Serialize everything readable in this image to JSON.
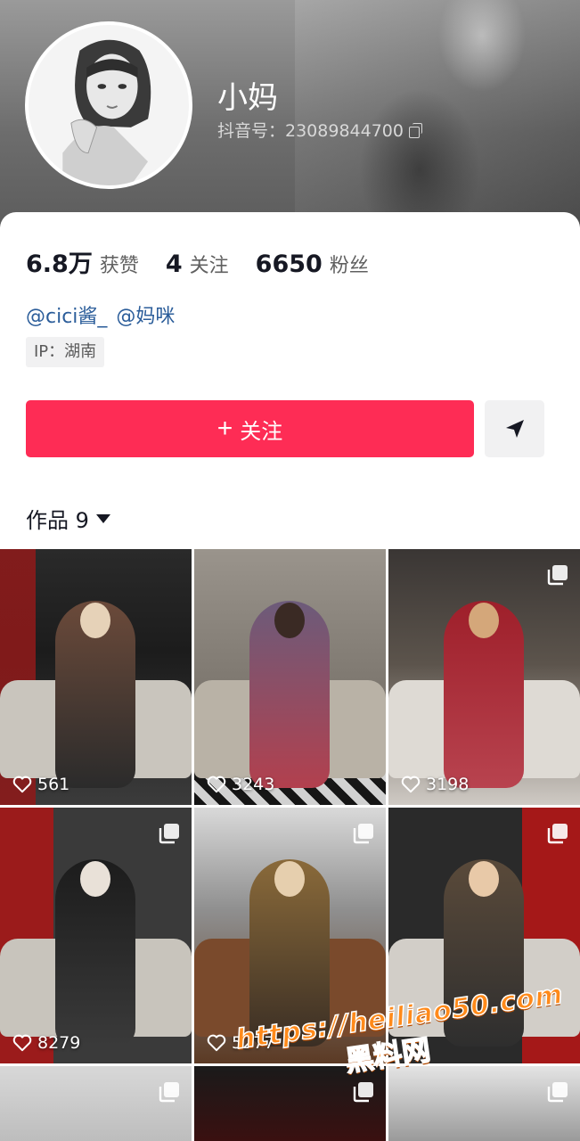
{
  "profile": {
    "nickname": "小妈",
    "douyin_id": "抖音号：23089844700",
    "stats": [
      {
        "value": "6.8万",
        "label": "获赞"
      },
      {
        "value": "4",
        "label": "关注"
      },
      {
        "value": "6650",
        "label": "粉丝"
      }
    ],
    "mentions": [
      "@cici酱_",
      "@妈咪"
    ],
    "ip": "IP：湖南"
  },
  "actions": {
    "follow_label": "关注",
    "follow_color": "#fe2c55"
  },
  "tabs": {
    "works_label": "作品 9"
  },
  "videos": [
    {
      "likes": "561",
      "multi": false
    },
    {
      "likes": "3243",
      "multi": false
    },
    {
      "likes": "3198",
      "multi": true
    },
    {
      "likes": "8279",
      "multi": true
    },
    {
      "likes": "5277",
      "multi": true
    },
    {
      "likes": "",
      "multi": true
    },
    {
      "likes": "",
      "multi": true
    },
    {
      "likes": "",
      "multi": true
    },
    {
      "likes": "",
      "multi": true
    }
  ],
  "watermark": {
    "url": "https://heiliao50.com",
    "text": "黑料网"
  }
}
